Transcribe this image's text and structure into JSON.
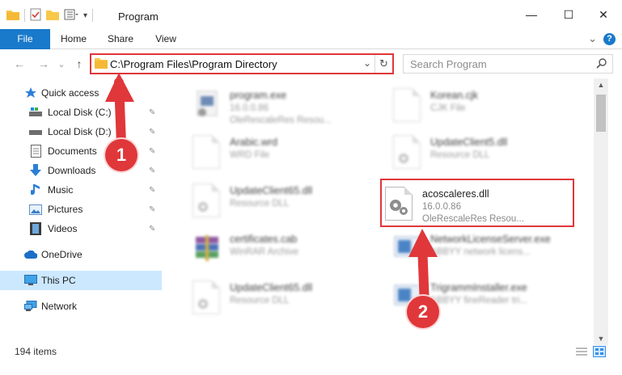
{
  "window": {
    "title": "Program",
    "minimize_glyph": "—",
    "maximize_glyph": "☐",
    "close_glyph": "✕"
  },
  "ribbon": {
    "tabs": [
      {
        "label": "File"
      },
      {
        "label": "Home"
      },
      {
        "label": "Share"
      },
      {
        "label": "View"
      }
    ],
    "expand_glyph": "⌄",
    "help_glyph": "?"
  },
  "navigation": {
    "back_glyph": "←",
    "forward_glyph": "→",
    "recent_glyph": "⌄",
    "up_glyph": "↑",
    "address_path": "C:\\Program Files\\Program Directory",
    "address_dropdown_glyph": "⌄",
    "refresh_glyph": "↻",
    "search_placeholder": "Search Program"
  },
  "sidebar": {
    "items": [
      {
        "label": "Quick access",
        "icon": "star-icon",
        "pinned": false
      },
      {
        "label": "Local Disk (C:)",
        "icon": "drive-icon",
        "pinned": true
      },
      {
        "label": "Local Disk (D:)",
        "icon": "drive-icon",
        "pinned": true
      },
      {
        "label": "Documents",
        "icon": "documents-icon",
        "pinned": true
      },
      {
        "label": "Downloads",
        "icon": "downloads-icon",
        "pinned": true
      },
      {
        "label": "Music",
        "icon": "music-icon",
        "pinned": true
      },
      {
        "label": "Pictures",
        "icon": "pictures-icon",
        "pinned": true
      },
      {
        "label": "Videos",
        "icon": "videos-icon",
        "pinned": true
      },
      {
        "label": "OneDrive",
        "icon": "cloud-icon",
        "pinned": false
      },
      {
        "label": "This PC",
        "icon": "computer-icon",
        "pinned": false,
        "selected": true
      },
      {
        "label": "Network",
        "icon": "network-icon",
        "pinned": false
      }
    ]
  },
  "files": [
    {
      "name": "program.exe",
      "line2": "16.0.0.86",
      "line3": "OleRescaleRes Resou...",
      "icon": "exe-icon"
    },
    {
      "name": "Korean.cjk",
      "line2": "CJK File",
      "line3": "",
      "icon": "document-icon"
    },
    {
      "name": "Arabic.wrd",
      "line2": "WRD File",
      "line3": "",
      "icon": "document-icon"
    },
    {
      "name": "UpdateClient5.dll",
      "line2": "Resource DLL",
      "line3": "",
      "icon": "dll-icon"
    },
    {
      "name": "UpdateClient65.dll",
      "line2": "Resource DLL",
      "line3": "",
      "icon": "dll-icon"
    },
    {
      "name": "acoscaleres.dll",
      "line2": "16.0.0.86",
      "line3": "OleRescaleRes Resou...",
      "icon": "gear-dll-icon"
    },
    {
      "name": "certificates.cab",
      "line2": "WinRAR Archive",
      "line3": "",
      "icon": "archive-icon"
    },
    {
      "name": "NetworkLicenseServer.exe",
      "line2": "ABBYY network licens...",
      "line3": "",
      "icon": "exe-icon"
    },
    {
      "name": "UpdateClient65.dll",
      "line2": "Resource DLL",
      "line3": "",
      "icon": "dll-icon"
    },
    {
      "name": "TrigrammInstaller.exe",
      "line2": "ABBYY fineReader tri...",
      "line3": "",
      "icon": "exe-icon"
    }
  ],
  "status": {
    "item_count": "194 items"
  },
  "callouts": [
    {
      "number": "1"
    },
    {
      "number": "2"
    }
  ],
  "colors": {
    "accent": "#1979ca",
    "annotation_red": "#e0373a",
    "selection": "#cce8ff",
    "folder_yellow": "#f8c84a"
  }
}
